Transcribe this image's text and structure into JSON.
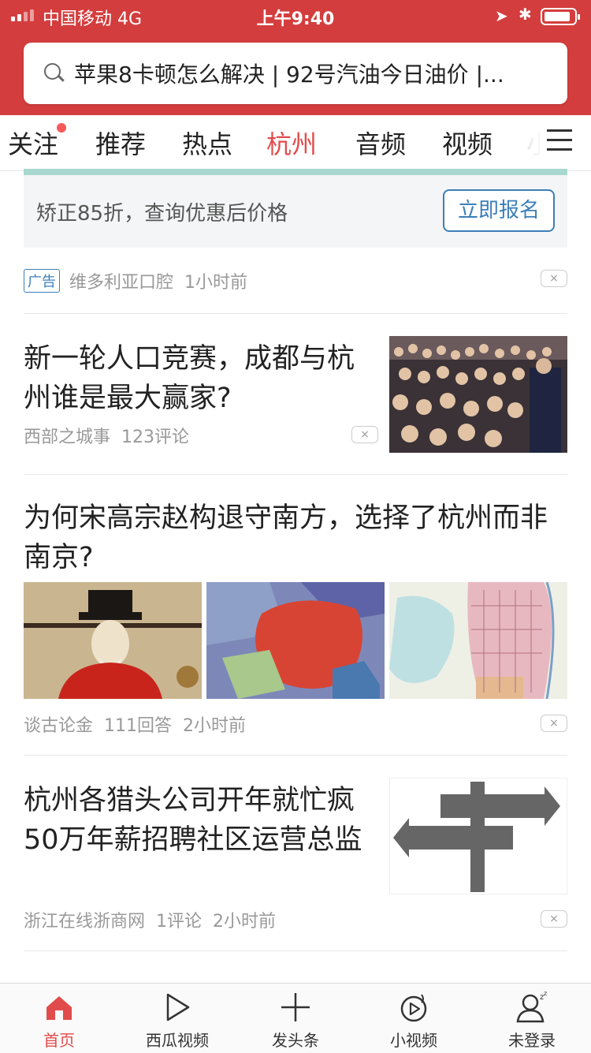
{
  "status": {
    "carrier": "中国移动  4G",
    "time": "上午9:40",
    "battery_level": 0.85
  },
  "search": {
    "placeholder_text": "苹果8卡顿怎么解决 | 92号汽油今日油价 |..."
  },
  "tabs": [
    {
      "label": "关注",
      "badge": true
    },
    {
      "label": "推荐"
    },
    {
      "label": "热点"
    },
    {
      "label": "杭州",
      "active": true
    },
    {
      "label": "音频"
    },
    {
      "label": "视频"
    },
    {
      "label": "小"
    }
  ],
  "ad": {
    "text": "矫正85折，查询优惠后价格",
    "button": "立即报名",
    "badge": "广告",
    "source": "维多利亚口腔",
    "time": "1小时前"
  },
  "feed": [
    {
      "title": "新一轮人口竞赛，成都与杭州谁是最大赢家?",
      "source": "西部之城事",
      "comments": "123评论"
    },
    {
      "title": "为何宋高宗赵构退守南方，选择了杭州而非南京?",
      "source": "谈古论金",
      "comments": "111回答",
      "time": "2小时前"
    },
    {
      "title": "杭州各猎头公司开年就忙疯 50万年薪招聘社区运营总监",
      "source": "浙江在线浙商网",
      "comments": "1评论",
      "time": "2小时前"
    }
  ],
  "dislike_glyph": "×",
  "tabbar": [
    {
      "label": "首页",
      "icon": "home-icon",
      "active": true
    },
    {
      "label": "西瓜视频",
      "icon": "play-icon"
    },
    {
      "label": "发头条",
      "icon": "plus-icon"
    },
    {
      "label": "小视频",
      "icon": "small-video-icon"
    },
    {
      "label": "未登录",
      "icon": "user-icon"
    }
  ],
  "colors": {
    "brand": "#d43d3d",
    "accent": "#e24b4b",
    "link": "#3c7fb8"
  }
}
